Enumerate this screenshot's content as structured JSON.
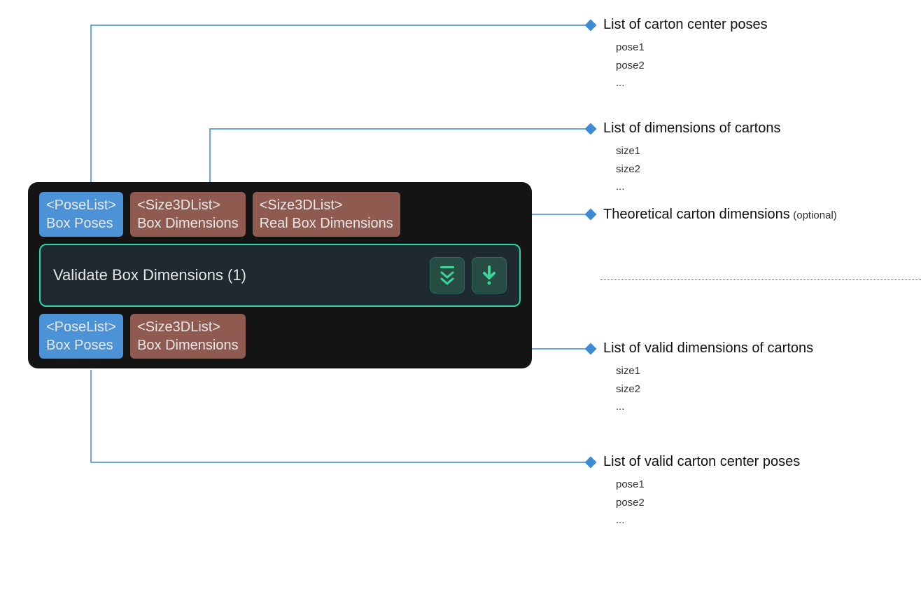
{
  "node": {
    "title": "Validate Box Dimensions (1)",
    "inputs": [
      {
        "type": "<PoseList>",
        "label": "Box Poses",
        "color": "blue"
      },
      {
        "type": "<Size3DList>",
        "label": "Box Dimensions",
        "color": "brown"
      },
      {
        "type": "<Size3DList>",
        "label": "Real Box Dimensions",
        "color": "brown"
      }
    ],
    "outputs": [
      {
        "type": "<PoseList>",
        "label": "Box Poses",
        "color": "blue"
      },
      {
        "type": "<Size3DList>",
        "label": "Box Dimensions",
        "color": "brown"
      }
    ],
    "actions": {
      "expand": "expand",
      "download": "download"
    }
  },
  "annotations": {
    "in_pose": {
      "title": "List of carton center poses",
      "items": [
        "pose1",
        "pose2",
        "..."
      ]
    },
    "in_dim": {
      "title": "List of dimensions of cartons",
      "items": [
        "size1",
        "size2",
        "..."
      ]
    },
    "in_real": {
      "title": "Theoretical carton dimensions",
      "optional": "(optional)"
    },
    "out_dim": {
      "title": "List of valid dimensions of cartons",
      "items": [
        "size1",
        "size2",
        "..."
      ]
    },
    "out_pose": {
      "title": "List of valid carton center poses",
      "items": [
        "pose1",
        "pose2",
        "..."
      ]
    }
  }
}
